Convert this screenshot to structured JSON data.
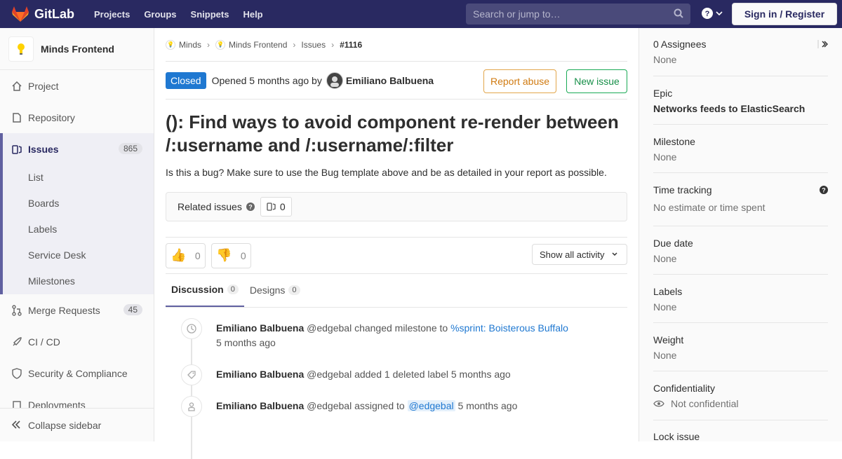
{
  "navbar": {
    "brand": "GitLab",
    "links": [
      "Projects",
      "Groups",
      "Snippets",
      "Help"
    ],
    "search_placeholder": "Search or jump to…",
    "signin": "Sign in / Register"
  },
  "sidebar": {
    "project_name": "Minds Frontend",
    "items": [
      {
        "label": "Project",
        "icon": "home-icon"
      },
      {
        "label": "Repository",
        "icon": "doc-icon"
      },
      {
        "label": "Issues",
        "icon": "issues-icon",
        "count": "865"
      },
      {
        "label": "Merge Requests",
        "icon": "merge-icon",
        "count": "45"
      },
      {
        "label": "CI / CD",
        "icon": "rocket-icon"
      },
      {
        "label": "Security & Compliance",
        "icon": "shield-icon"
      },
      {
        "label": "Deployments",
        "icon": "deploy-icon"
      }
    ],
    "issues_sub": [
      "List",
      "Boards",
      "Labels",
      "Service Desk",
      "Milestones"
    ],
    "collapse": "Collapse sidebar"
  },
  "breadcrumb": {
    "a": "Minds",
    "b": "Minds Frontend",
    "c": "Issues",
    "d": "#1116"
  },
  "issue": {
    "status": "Closed",
    "opened_prefix": "Opened 5 months ago by",
    "author": "Emiliano Balbuena",
    "report_abuse": "Report abuse",
    "new_issue": "New issue",
    "title": "(): Find ways to avoid component re-render between /:username and /:username/:filter",
    "description": "Is this a bug? Make sure to use the Bug template above and be as detailed in your report as possible.",
    "related_label": "Related issues",
    "related_count": "0"
  },
  "awards": {
    "thumbsup": "0",
    "thumbsdown": "0",
    "activity": "Show all activity"
  },
  "tabs": {
    "discussion": "Discussion",
    "discussion_count": "0",
    "designs": "Designs",
    "designs_count": "0"
  },
  "timeline": [
    {
      "author": "Emiliano Balbuena",
      "handle": "@edgebal",
      "action": "changed milestone to",
      "link": "%sprint: Boisterous Buffalo",
      "time": "5 months ago",
      "icon": "clock-icon"
    },
    {
      "author": "Emiliano Balbuena",
      "handle": "@edgebal",
      "action": "added 1 deleted label",
      "time": "5 months ago",
      "icon": "tag-icon"
    },
    {
      "author": "Emiliano Balbuena",
      "handle": "@edgebal",
      "action": "assigned to",
      "mention": "@edgebal",
      "time": "5 months ago",
      "icon": "user-icon"
    }
  ],
  "rsidebar": {
    "assignees": "0 Assignees",
    "assignees_val": "None",
    "epic": "Epic",
    "epic_val": "Networks feeds to ElasticSearch",
    "milestone": "Milestone",
    "milestone_val": "None",
    "time": "Time tracking",
    "time_val": "No estimate or time spent",
    "due": "Due date",
    "due_val": "None",
    "labels": "Labels",
    "labels_val": "None",
    "weight": "Weight",
    "weight_val": "None",
    "conf": "Confidentiality",
    "conf_val": "Not confidential",
    "lock": "Lock issue"
  }
}
